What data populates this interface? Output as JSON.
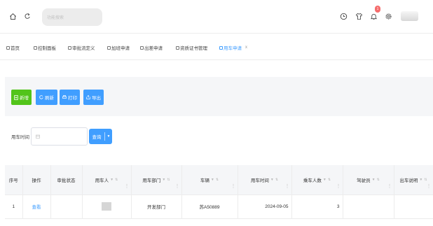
{
  "header": {
    "search_placeholder": "功能搜索",
    "notification_count": "1",
    "icons": [
      "home-icon",
      "refresh-icon",
      "clock-icon",
      "shirt-icon",
      "bell-icon",
      "settings-icon"
    ]
  },
  "tabs": [
    {
      "label": "首页",
      "active": false
    },
    {
      "label": "控制面板",
      "active": false
    },
    {
      "label": "审批流定义",
      "active": false
    },
    {
      "label": "加班申请",
      "active": false
    },
    {
      "label": "出差申请",
      "active": false
    },
    {
      "label": "资质证书管理",
      "active": false
    },
    {
      "label": "用车申请",
      "active": true
    }
  ],
  "tab_close": "x",
  "toolbar": {
    "add_label": "新增",
    "refresh_label": "刷新",
    "print_label": "打印",
    "export_label": "导出",
    "add_color": "#52c41a",
    "primary_color": "#409eff"
  },
  "filter": {
    "label": "用车时间",
    "query_label": "查询"
  },
  "table": {
    "columns": [
      "序号",
      "操作",
      "审批状态",
      "用车人",
      "用车部门",
      "车辆",
      "用车时间",
      "乘车人数",
      "驾驶员",
      "出车说明"
    ],
    "rows": [
      {
        "index": "1",
        "action": "查看",
        "status": "",
        "department": "开发部门",
        "vehicle": "苏A50889",
        "time": "2024-09-05",
        "passengers": "3",
        "driver": "",
        "note": ""
      }
    ]
  }
}
